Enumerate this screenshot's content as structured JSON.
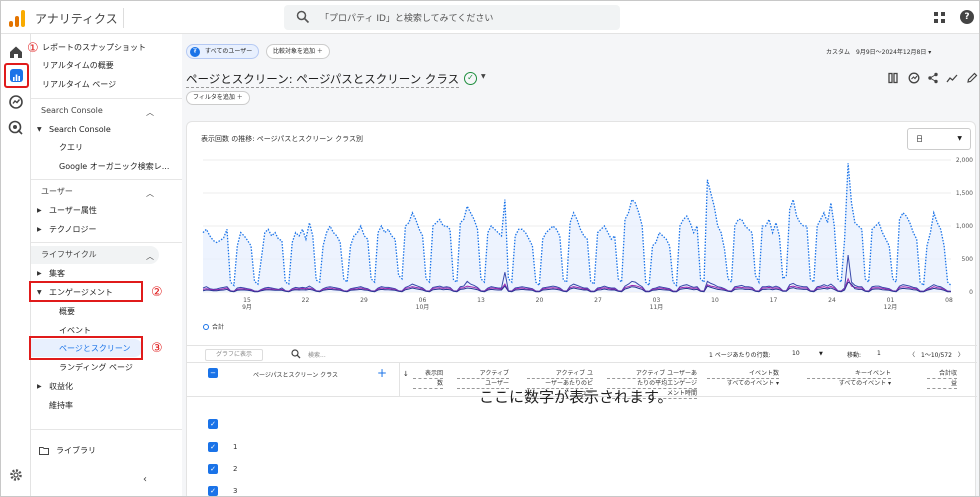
{
  "header": {
    "app_name": "アナリティクス",
    "search_placeholder": "「プロパティ ID」と検索してみてください",
    "logo_colors": [
      "#f9ab00",
      "#e37400",
      "#e37400"
    ]
  },
  "rail": {
    "icons": [
      "home-icon",
      "reports-icon",
      "explore-icon",
      "advertising-icon",
      "settings-icon"
    ]
  },
  "sidebar": {
    "top_items": [
      "レポートのスナップショット",
      "リアルタイムの概要",
      "リアルタイム ページ"
    ],
    "section_search_console": "Search Console",
    "search_console_group": "Search Console",
    "search_console_children": [
      "クエリ",
      "Google オーガニック検索レ..."
    ],
    "section_user": "ユーザー",
    "user_items": [
      "ユーザー属性",
      "テクノロジー"
    ],
    "section_lifecycle": "ライフサイクル",
    "acquisition": "集客",
    "engagement": "エンゲージメント",
    "engagement_children": [
      "概要",
      "イベント",
      "ページとスクリーン",
      "ランディング ページ"
    ],
    "monetization": "収益化",
    "retention": "維持率",
    "library": "ライブラリ"
  },
  "annotations": {
    "one": "①",
    "two": "②",
    "three": "③"
  },
  "main": {
    "chip_all_users": "すべてのユーザー",
    "chip_compare": "比較対象を追加 ＋",
    "date_range": "カスタム　9月9日～2024年12月8日 ▾",
    "title": "ページとスクリーン: ページパスとスクリーン クラス",
    "filter": "フィルタを追加 ＋",
    "card_title": "表示回数 の推移: ページパスとスクリーン クラス別",
    "granularity": "日",
    "legend": "合計",
    "overlay_message": "ここに数字が表示されます。"
  },
  "chart_data": {
    "type": "line",
    "y_ticks": [
      "2,000",
      "1,500",
      "1,000",
      "500",
      "0"
    ],
    "ylim": [
      0,
      2000
    ],
    "x_ticks": [
      {
        "day": "15",
        "month": "9月"
      },
      {
        "day": "22",
        "month": ""
      },
      {
        "day": "29",
        "month": ""
      },
      {
        "day": "06",
        "month": "10月"
      },
      {
        "day": "13",
        "month": ""
      },
      {
        "day": "20",
        "month": ""
      },
      {
        "day": "27",
        "month": ""
      },
      {
        "day": "03",
        "month": "11月"
      },
      {
        "day": "10",
        "month": ""
      },
      {
        "day": "17",
        "month": ""
      },
      {
        "day": "24",
        "month": ""
      },
      {
        "day": "01",
        "month": "12月"
      },
      {
        "day": "08",
        "month": ""
      }
    ],
    "series": [
      {
        "name": "合計",
        "values": [
          900,
          950,
          850,
          780,
          750,
          780,
          820,
          950,
          150,
          100,
          700,
          900,
          850,
          780,
          700,
          160,
          120,
          500,
          900,
          950,
          850,
          900,
          800,
          780,
          150,
          120,
          750,
          900,
          850,
          950,
          800,
          1050,
          850,
          180,
          150,
          700,
          900,
          1000,
          900,
          850,
          750,
          200,
          150,
          700,
          850,
          900,
          1000,
          850,
          800,
          200,
          150,
          900,
          1000,
          900,
          950,
          850,
          800,
          250,
          200,
          1000,
          1050,
          1200,
          1100,
          950,
          850,
          200,
          150,
          1000,
          1050,
          1100,
          1000,
          1000,
          950,
          180,
          150,
          1050,
          1100,
          1300,
          1200,
          1100,
          950,
          200,
          150,
          900,
          1000,
          950,
          900,
          850,
          1400,
          200,
          150,
          850,
          950,
          950,
          900,
          800,
          700,
          150,
          100,
          800,
          900,
          950,
          1000,
          950,
          850,
          180,
          150,
          1050,
          1200,
          1100,
          950,
          850,
          800,
          160,
          120,
          900,
          950,
          1000,
          900,
          800,
          850,
          200,
          150,
          1100,
          1200,
          1400,
          1350,
          1200,
          1000,
          150,
          100,
          700,
          750,
          900,
          850,
          800,
          700,
          150,
          100,
          1000,
          1100,
          1150,
          1050,
          900,
          1000,
          200,
          150,
          1700,
          1500,
          1300,
          1000,
          900,
          650,
          200,
          150,
          1000,
          1100,
          1100,
          1000,
          950,
          900,
          250,
          150,
          1000,
          1000,
          1100,
          900,
          1050,
          850,
          200,
          250,
          1250,
          1400,
          1150,
          1050,
          1000,
          1000,
          200,
          150,
          1000,
          1100,
          1200,
          1050,
          1350,
          1000,
          200,
          150,
          800,
          1950,
          1350,
          1050,
          1000,
          950,
          200,
          150,
          950,
          1000,
          1050,
          900,
          800,
          700,
          200,
          150,
          1100,
          1200,
          1150,
          1050,
          900,
          800,
          150,
          100,
          700,
          900,
          1200,
          1050,
          950,
          700,
          150,
          100
        ]
      },
      {
        "name": "",
        "values": [
          60,
          80,
          50,
          40,
          45,
          60,
          70,
          80,
          20,
          10,
          60,
          70,
          60,
          50,
          40,
          15,
          10,
          40,
          60,
          70,
          60,
          50,
          40,
          60,
          20,
          10,
          50,
          70,
          60,
          70,
          60,
          90,
          60,
          20,
          15,
          50,
          70,
          80,
          70,
          60,
          50,
          20,
          15,
          50,
          60,
          70,
          80,
          60,
          50,
          20,
          15,
          60,
          80,
          70,
          70,
          60,
          50,
          20,
          15,
          70,
          90,
          120,
          100,
          80,
          60,
          20,
          15,
          70,
          80,
          90,
          70,
          80,
          70,
          20,
          15,
          80,
          90,
          160,
          120,
          100,
          70,
          20,
          15,
          60,
          80,
          70,
          60,
          60,
          300,
          20,
          15,
          60,
          70,
          80,
          70,
          60,
          50,
          15,
          10,
          60,
          70,
          80,
          90,
          80,
          60,
          20,
          15,
          90,
          120,
          100,
          80,
          60,
          60,
          15,
          10,
          60,
          70,
          90,
          70,
          60,
          60,
          20,
          15,
          90,
          120,
          160,
          150,
          110,
          80,
          15,
          10,
          50,
          60,
          80,
          70,
          60,
          50,
          15,
          10,
          80,
          100,
          110,
          90,
          70,
          80,
          20,
          15,
          160,
          130,
          110,
          80,
          70,
          50,
          20,
          15,
          80,
          90,
          100,
          80,
          80,
          70,
          20,
          15,
          80,
          80,
          90,
          70,
          90,
          70,
          20,
          20,
          110,
          130,
          100,
          90,
          80,
          80,
          20,
          15,
          80,
          90,
          110,
          90,
          120,
          80,
          20,
          15,
          60,
          560,
          150,
          100,
          80,
          80,
          20,
          15,
          80,
          90,
          90,
          70,
          60,
          50,
          20,
          15,
          90,
          110,
          100,
          90,
          70,
          60,
          15,
          10,
          50,
          80,
          110,
          90,
          80,
          50,
          15,
          10
        ]
      },
      {
        "name": "",
        "values": [
          40,
          50,
          40,
          30,
          35,
          40,
          50,
          60,
          15,
          10,
          40,
          50,
          45,
          40,
          30,
          10,
          8,
          30,
          45,
          50,
          45,
          40,
          35,
          40,
          15,
          10,
          40,
          50,
          45,
          55,
          45,
          60,
          45,
          15,
          10,
          40,
          50,
          60,
          50,
          45,
          40,
          15,
          10,
          40,
          45,
          50,
          60,
          45,
          40,
          15,
          10,
          45,
          60,
          50,
          55,
          45,
          40,
          15,
          10,
          55,
          65,
          80,
          70,
          60,
          45,
          15,
          10,
          55,
          60,
          65,
          55,
          60,
          55,
          15,
          10,
          60,
          65,
          90,
          80,
          70,
          55,
          15,
          10,
          45,
          60,
          55,
          50,
          45,
          120,
          15,
          10,
          45,
          55,
          60,
          50,
          45,
          40,
          10,
          8,
          45,
          55,
          60,
          65,
          60,
          45,
          15,
          10,
          65,
          80,
          70,
          60,
          45,
          45,
          10,
          8,
          45,
          55,
          65,
          55,
          45,
          45,
          15,
          10,
          70,
          80,
          100,
          95,
          80,
          60,
          10,
          8,
          40,
          45,
          60,
          55,
          45,
          40,
          10,
          8,
          60,
          70,
          75,
          65,
          55,
          60,
          15,
          10,
          110,
          90,
          80,
          60,
          55,
          40,
          15,
          10,
          60,
          70,
          70,
          60,
          60,
          55,
          15,
          10,
          60,
          60,
          70,
          55,
          65,
          55,
          15,
          15,
          80,
          90,
          75,
          65,
          60,
          60,
          15,
          10,
          60,
          70,
          80,
          65,
          85,
          60,
          15,
          10,
          45,
          200,
          90,
          70,
          60,
          60,
          15,
          10,
          60,
          65,
          65,
          55,
          45,
          40,
          15,
          10,
          70,
          80,
          75,
          65,
          55,
          45,
          10,
          8,
          40,
          55,
          80,
          65,
          60,
          40,
          10,
          8
        ]
      },
      {
        "name": "",
        "values": [
          20,
          30,
          25,
          20,
          20,
          25,
          30,
          40,
          10,
          5,
          25,
          30,
          30,
          25,
          20,
          5,
          5,
          20,
          30,
          35,
          30,
          25,
          25,
          25,
          10,
          5,
          25,
          35,
          30,
          35,
          30,
          40,
          30,
          10,
          5,
          25,
          35,
          40,
          35,
          30,
          25,
          10,
          5,
          25,
          30,
          35,
          40,
          30,
          25,
          10,
          5,
          30,
          40,
          35,
          35,
          30,
          25,
          10,
          5,
          35,
          45,
          60,
          50,
          40,
          30,
          10,
          5,
          35,
          40,
          45,
          35,
          40,
          35,
          10,
          5,
          40,
          45,
          60,
          55,
          45,
          35,
          10,
          5,
          30,
          40,
          35,
          30,
          30,
          90,
          10,
          5,
          30,
          35,
          40,
          35,
          30,
          25,
          5,
          5,
          30,
          35,
          40,
          45,
          40,
          30,
          10,
          5,
          45,
          60,
          50,
          40,
          30,
          30,
          5,
          5,
          30,
          35,
          45,
          35,
          30,
          30,
          10,
          5,
          45,
          60,
          80,
          75,
          55,
          40,
          5,
          5,
          25,
          30,
          40,
          35,
          30,
          25,
          5,
          5,
          40,
          50,
          55,
          45,
          35,
          40,
          10,
          5,
          90,
          70,
          55,
          40,
          35,
          25,
          10,
          5,
          40,
          45,
          50,
          40,
          40,
          35,
          10,
          5,
          40,
          40,
          45,
          35,
          45,
          35,
          10,
          10,
          55,
          65,
          50,
          45,
          40,
          40,
          10,
          5,
          40,
          45,
          55,
          45,
          60,
          40,
          10,
          5,
          30,
          150,
          120,
          50,
          40,
          40,
          10,
          5,
          40,
          45,
          45,
          35,
          30,
          25,
          10,
          5,
          45,
          55,
          50,
          45,
          35,
          30,
          5,
          5,
          25,
          40,
          55,
          45,
          40,
          25,
          5,
          5
        ]
      }
    ],
    "colors": [
      "#1a73e8",
      "#3949ab",
      "#9c27b0",
      "#283593"
    ],
    "grid": true,
    "legend_position": "bottom-left"
  },
  "table": {
    "graph_button": "グラフに表示",
    "search_placeholder": "検索...",
    "rows_per_page_label": "1 ページあたりの行数:",
    "rows_per_page": "10",
    "move_label": "移動:",
    "move_value": "1",
    "range": "〈　1〜10/572　〉",
    "dimension_header": "ページパスとスクリーン クラス",
    "metric_headers": [
      {
        "l1": "表示回",
        "l2": "数",
        "l3": ""
      },
      {
        "l1": "アクティブ",
        "l2": "ユーザー",
        "l3": ""
      },
      {
        "l1": "アクティブ ユ",
        "l2": "ーザーあたりのビ",
        "l3": "ュー"
      },
      {
        "l1": "アクティブ ユーザーあ",
        "l2": "たりの平均エンゲージ",
        "l3": "メント時間"
      },
      {
        "l1": "イベント数",
        "l2": "すべてのイベント ▾",
        "l3": ""
      },
      {
        "l1": "キーイベント",
        "l2": "すべてのイベント ▾",
        "l3": ""
      },
      {
        "l1": "合計収",
        "l2": "益",
        "l3": ""
      }
    ],
    "row_numbers": [
      "1",
      "2",
      "3"
    ]
  }
}
